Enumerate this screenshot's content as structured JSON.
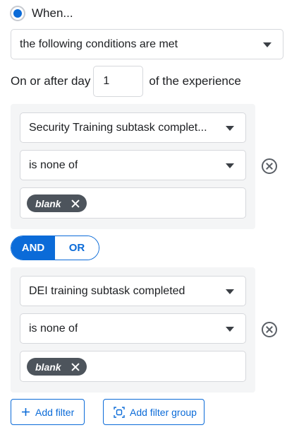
{
  "when": {
    "label": "When...",
    "selected": true
  },
  "condition_select": {
    "value": "the following conditions are met"
  },
  "day_row": {
    "prefix": "On or after day",
    "day_value": "1",
    "suffix": "of the experience"
  },
  "groups": [
    {
      "field": "Security Training subtask complet...",
      "operator": "is none of",
      "chips": [
        "blank"
      ]
    },
    {
      "field": "DEI training subtask completed",
      "operator": "is none of",
      "chips": [
        "blank"
      ]
    }
  ],
  "logic_toggle": {
    "and_label": "AND",
    "or_label": "OR",
    "selected": "AND"
  },
  "buttons": {
    "add_filter": "Add filter",
    "add_filter_group": "Add filter group"
  },
  "colors": {
    "accent": "#0b6bd8",
    "chip_bg": "#4d545c",
    "group_bg": "#f4f5f6"
  }
}
